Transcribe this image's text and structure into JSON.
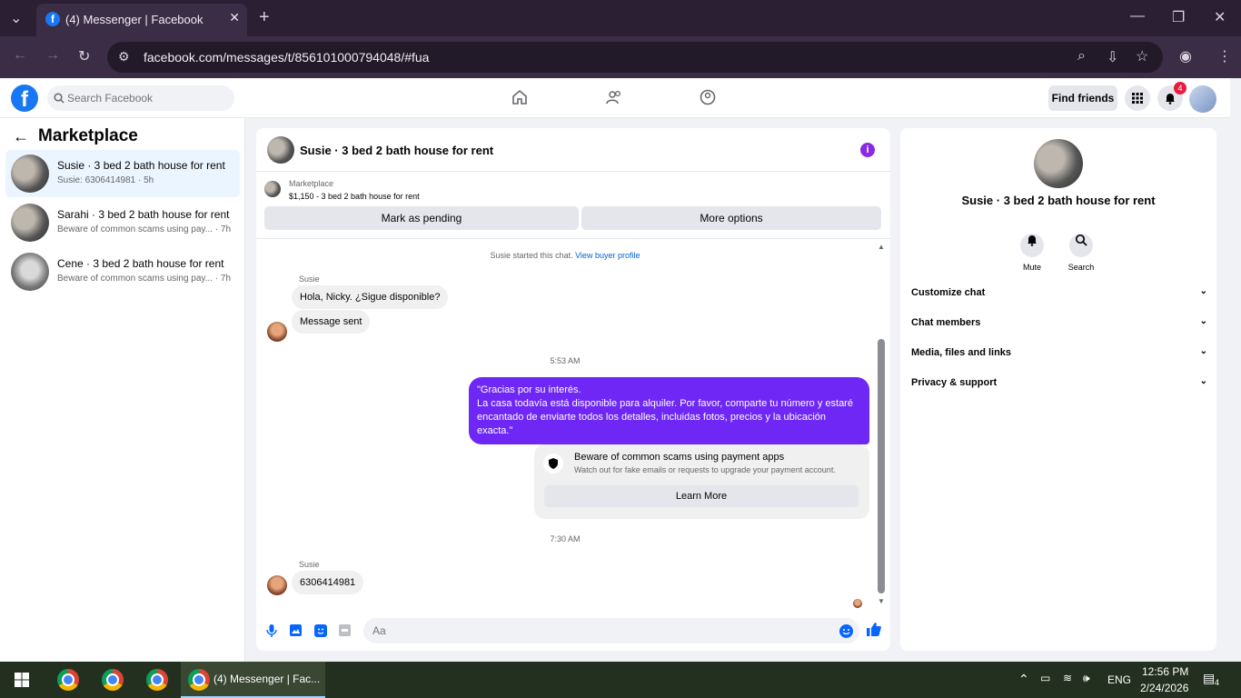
{
  "browser": {
    "tab_title": "(4) Messenger | Facebook",
    "url": "facebook.com/messages/t/856101000794048/#fua"
  },
  "header": {
    "search_placeholder": "Search Facebook",
    "find_friends": "Find friends",
    "notification_count": "4"
  },
  "sidebar": {
    "title": "Marketplace",
    "conversations": [
      {
        "name": "Susie · 3 bed 2 bath house for rent",
        "snippet": "Susie: 6306414981 · 5h"
      },
      {
        "name": "Sarahi · 3 bed 2 bath house for rent",
        "snippet": "Beware of common scams using pay... · 7h"
      },
      {
        "name": "Cene · 3 bed 2 bath house for rent",
        "snippet": "Beware of common scams using pay... · 7h"
      }
    ]
  },
  "chat": {
    "title": "Susie · 3 bed 2 bath house for rent",
    "listing_category": "Marketplace",
    "listing_desc": "$1,150 - 3 bed 2 bath house for rent",
    "mark_pending": "Mark as pending",
    "more_options": "More options",
    "started_text": "Susie started this chat.",
    "view_profile": "View buyer profile",
    "sender1": "Susie",
    "msg1": "Hola, Nicky. ¿Sigue disponible?",
    "msg2": "Message sent",
    "time1": "5:53 AM",
    "out_line1": "\"Gracias por su interés.",
    "out_line2": "La casa todavía está disponible para alquiler. Por favor, comparte tu número y estaré encantado de enviarte todos los detalles, incluidas fotos, precios y la ubicación exacta.\"",
    "scam_title": "Beware of common scams using payment apps",
    "scam_sub": "Watch out for fake emails or requests to upgrade your payment account.",
    "learn_more": "Learn More",
    "time2": "7:30 AM",
    "sender2": "Susie",
    "msg3": "6306414981",
    "composer_placeholder": "Aa"
  },
  "details": {
    "title": "Susie · 3 bed 2 bath house for rent",
    "mute": "Mute",
    "search": "Search",
    "sections": [
      "Customize chat",
      "Chat members",
      "Media, files and links",
      "Privacy & support"
    ]
  },
  "taskbar": {
    "active_label": "(4) Messenger | Fac...",
    "lang": "ENG",
    "time": "12:56 PM",
    "date": "2/24/2026",
    "notif": "4"
  },
  "colors": {
    "accent": "#6e27f5",
    "fb_blue": "#1877f2",
    "chrome_bg": "#3b2d45"
  }
}
